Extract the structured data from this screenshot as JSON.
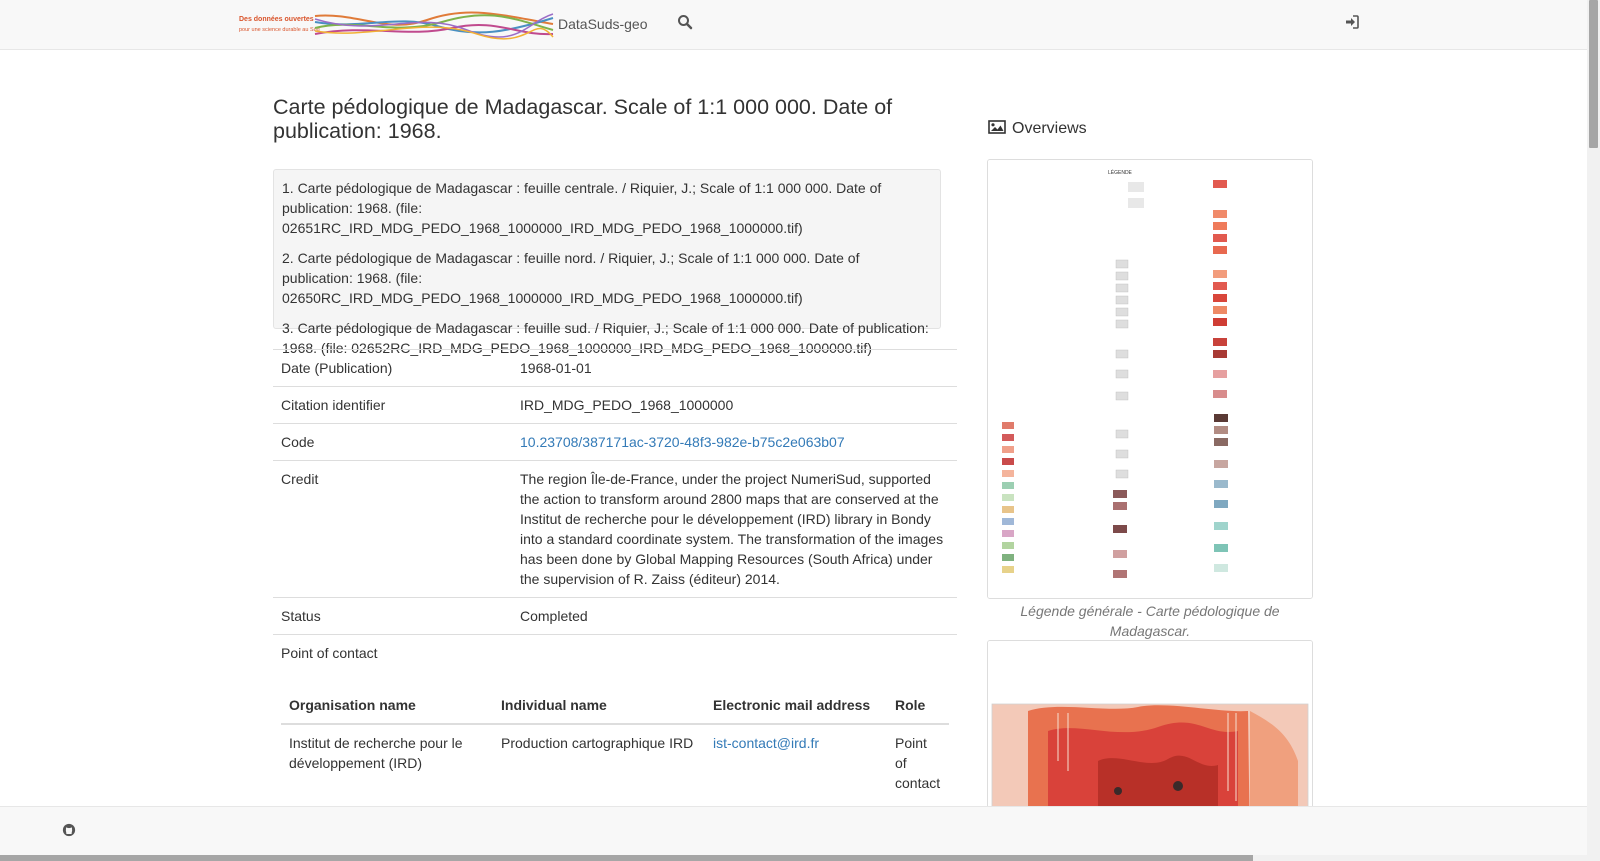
{
  "navbar": {
    "brand": "DataSuds-geo",
    "logo_text": "Des données ouvertes pour une science durable au Sud",
    "search_icon": "search-icon",
    "login_icon": "sign-in-icon"
  },
  "record": {
    "title": "Carte pédologique de Madagascar. Scale of 1:1 000 000. Date of publication: 1968.",
    "abstract": [
      "1. Carte pédologique de Madagascar : feuille centrale. / Riquier, J.; Scale of 1:1 000 000. Date of publication: 1968. (file: 02651RC_IRD_MDG_PEDO_1968_1000000_IRD_MDG_PEDO_1968_1000000.tif)",
      "2. Carte pédologique de Madagascar : feuille nord. / Riquier, J.; Scale of 1:1 000 000. Date of publication: 1968. (file: 02650RC_IRD_MDG_PEDO_1968_1000000_IRD_MDG_PEDO_1968_1000000.tif)",
      "3. Carte pédologique de Madagascar : feuille sud. / Riquier, J.; Scale of 1:1 000 000. Date of publication: 1968. (file: 02652RC_IRD_MDG_PEDO_1968_1000000_IRD_MDG_PEDO_1968_1000000.tif)"
    ],
    "fields": [
      {
        "label": "Date (Publication)",
        "value": "1968-01-01"
      },
      {
        "label": "Citation identifier",
        "value": "IRD_MDG_PEDO_1968_1000000"
      },
      {
        "label": "Code",
        "value": "10.23708/387171ac-3720-48f3-982e-b75c2e063b07"
      },
      {
        "label": "Credit",
        "value": "The region Île-de-France, under the project NumeriSud, supported the action to transform around 2800 maps that are conserved at the Institut de recherche pour le développement (IRD) library in Bondy into a standard coordinate system. The transformation of the images has been done by Global Mapping Resources (South Africa) under the supervision of R. Zaiss (éditeur) 2014."
      },
      {
        "label": "Status",
        "value": "Completed"
      }
    ],
    "point_of_contact": {
      "label": "Point of contact",
      "headers": [
        "Organisation name",
        "Individual name",
        "Electronic mail address",
        "Role"
      ],
      "rows": [
        {
          "org": "Institut de recherche pour le développement (IRD)",
          "individual": "Production cartographique IRD",
          "email": "ist-contact@ird.fr",
          "role": "Point of contact"
        }
      ]
    }
  },
  "overviews": {
    "heading": "Overviews",
    "heading_icon": "image-icon",
    "items": [
      {
        "caption": "Légende générale - Carte pédologique de Madagascar."
      },
      {
        "caption": ""
      }
    ]
  },
  "footer": {
    "icon": "github-icon"
  },
  "colors": {
    "link": "#337ab7",
    "navbar_bg": "#f8f8f8",
    "well_bg": "#f5f5f5",
    "border": "#dddddd"
  }
}
